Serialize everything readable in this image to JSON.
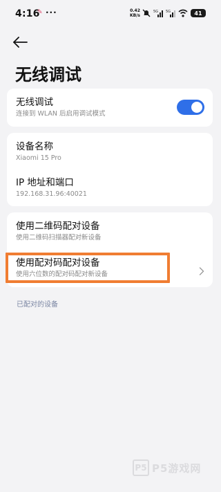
{
  "status_bar": {
    "time": "4:16",
    "dots": "···",
    "net_speed_value": "0.42",
    "net_speed_unit": "KB/s",
    "battery": "41"
  },
  "header": {
    "title": "无线调试"
  },
  "wireless_debug": {
    "title": "无线调试",
    "subtitle": "连接到 WLAN 后启用调试模式",
    "enabled": true
  },
  "device_info": {
    "name_label": "设备名称",
    "name_value": "Xiaomi 15 Pro",
    "ip_label": "IP 地址和端口",
    "ip_value": "192.168.31.96:40021"
  },
  "pairing": {
    "qr_title": "使用二维码配对设备",
    "qr_subtitle": "使用二维码扫描器配对新设备",
    "code_title": "使用配对码配对设备",
    "code_subtitle": "使用六位数的配对码配对新设备"
  },
  "paired_section_label": "已配对的设备",
  "watermark": {
    "logo_text": "P5",
    "text": "P5游戏网"
  },
  "colors": {
    "accent": "#2f6fe8",
    "highlight": "#f07d32",
    "background": "#f3f3f5"
  }
}
